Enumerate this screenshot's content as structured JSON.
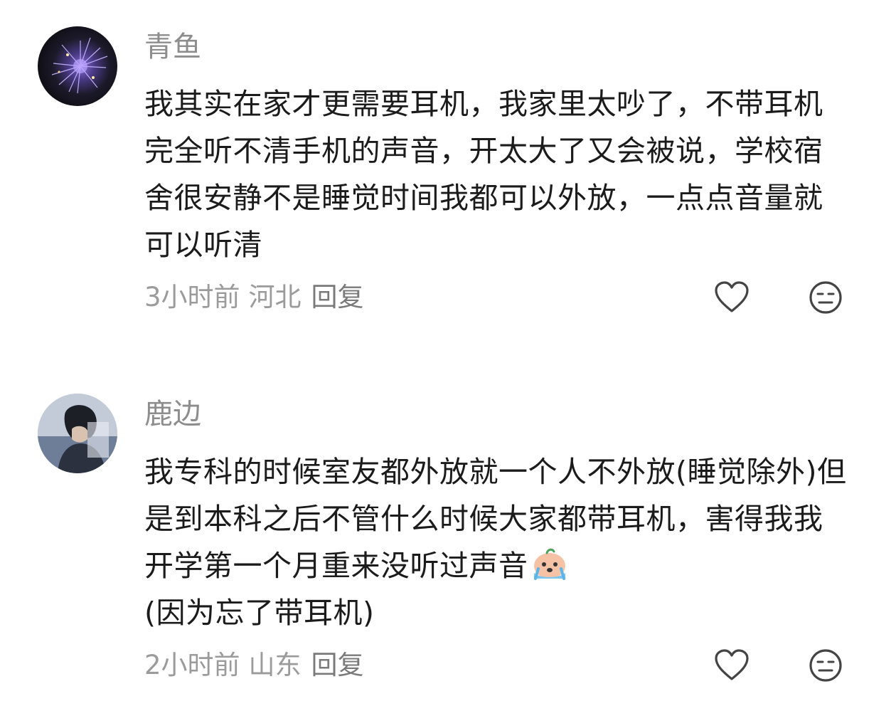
{
  "comments": [
    {
      "username": "青鱼",
      "content": "我其实在家才更需要耳机，我家里太吵了，不带耳机完全听不清手机的声音，开太大了又会被说，学校宿舍很安静不是睡觉时间我都可以外放，一点点音量就可以听清",
      "time": "3小时前",
      "location": "河北",
      "reply_label": "回复",
      "like_icon": "heart-outline-icon",
      "dislike_icon": "neutral-face-icon"
    },
    {
      "username": "鹿边",
      "content": "我专科的时候室友都外放就一个人不外放(睡觉除外)但是到本科之后不管什么时候大家都带耳机，害得我我开学第一个月重来没听过声音",
      "content_tail": "(因为忘了带耳机)",
      "inline_emoji": "crying-emoji",
      "time": "2小时前",
      "location": "山东",
      "reply_label": "回复",
      "like_icon": "heart-outline-icon",
      "dislike_icon": "neutral-face-icon"
    }
  ],
  "colors": {
    "text": "#1b1b1b",
    "username": "#8d8d8d",
    "meta": "#9b9b9b",
    "icon": "#444444"
  }
}
